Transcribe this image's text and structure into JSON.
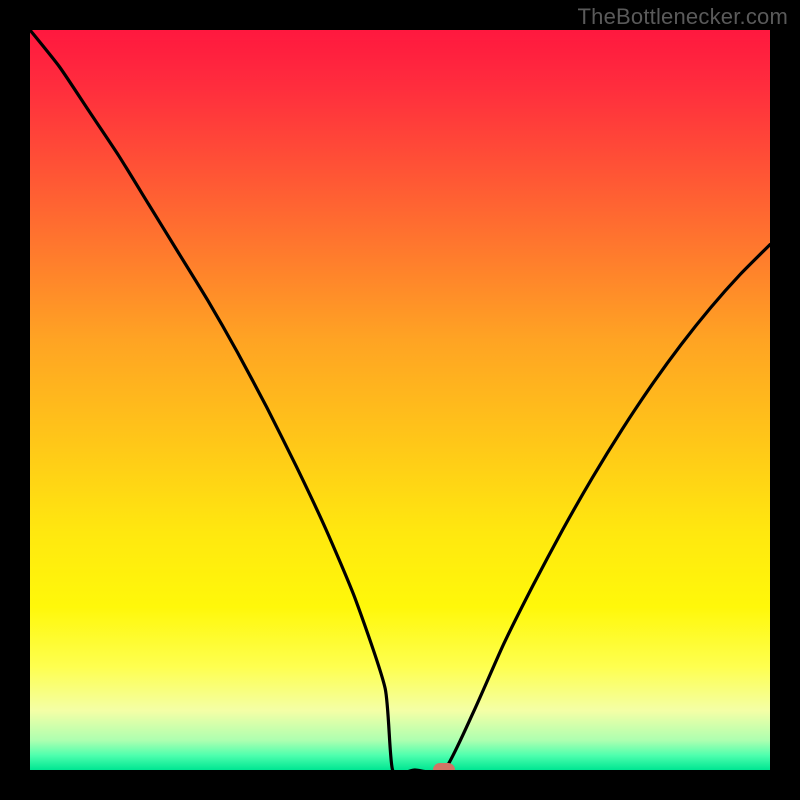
{
  "attribution": "TheBottlenecker.com",
  "chart_data": {
    "type": "line",
    "title": "",
    "xlabel": "",
    "ylabel": "",
    "xlim": [
      0,
      100
    ],
    "ylim": [
      0,
      100
    ],
    "x": [
      0,
      4,
      8,
      12,
      16,
      20,
      24,
      28,
      32,
      36,
      40,
      44,
      48,
      49,
      52,
      56,
      60,
      64,
      68,
      72,
      76,
      80,
      84,
      88,
      92,
      96,
      100
    ],
    "values": [
      100,
      95,
      89,
      83,
      76.5,
      70,
      63.5,
      56.5,
      49,
      41,
      32.5,
      23,
      11,
      0,
      0,
      0,
      8,
      17,
      25,
      32.5,
      39.5,
      46,
      52,
      57.5,
      62.5,
      67,
      71
    ],
    "marker": {
      "x": 56,
      "y": 0
    },
    "gradient_stops": [
      {
        "pos": 0,
        "color": "#ff183f"
      },
      {
        "pos": 30,
        "color": "#ff7a2d"
      },
      {
        "pos": 68,
        "color": "#ffe80f"
      },
      {
        "pos": 100,
        "color": "#00e692"
      }
    ]
  }
}
